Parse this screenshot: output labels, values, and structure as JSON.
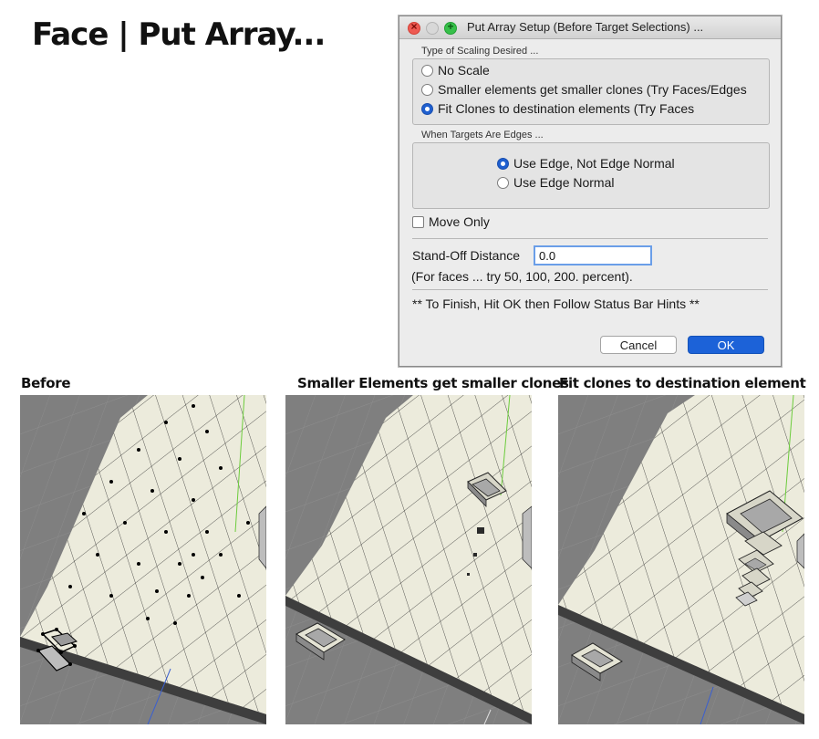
{
  "heading": "Face | Put Array...",
  "dialog": {
    "title": "Put Array Setup (Before Target Selections) ...",
    "scaling_group": {
      "label": "Type of Scaling Desired ...",
      "options": [
        {
          "label": "No Scale",
          "selected": false
        },
        {
          "label": "Smaller elements get smaller clones (Try Faces/Edges",
          "selected": false
        },
        {
          "label": "Fit Clones to destination elements (Try Faces",
          "selected": true
        }
      ]
    },
    "edges_group": {
      "label": "When Targets Are Edges ...",
      "options": [
        {
          "label": "Use Edge, Not Edge Normal",
          "selected": true
        },
        {
          "label": "Use Edge Normal",
          "selected": false
        }
      ]
    },
    "move_only": {
      "label": "Move Only",
      "checked": false
    },
    "standoff": {
      "label": "Stand-Off Distance",
      "value": "0.0"
    },
    "hint_faces": "(For faces ... try 50, 100, 200. percent).",
    "hint_finish": "** To Finish, Hit OK then Follow Status Bar Hints **",
    "buttons": {
      "cancel": "Cancel",
      "ok": "OK"
    },
    "colors": {
      "accent": "#1c62d8",
      "close": "#ee5a52",
      "zoom": "#37c04a"
    }
  },
  "panels": [
    {
      "caption": "Before"
    },
    {
      "caption": "Smaller Elements get smaller clones"
    },
    {
      "caption": "Fit clones to destination element"
    }
  ],
  "viewport_colors": {
    "ground": "#7f7f7f",
    "plane": "#ecebdc",
    "grid_line": "#2a2a2a",
    "axis_green": "#6ccc3c",
    "axis_blue": "#3a5fd0"
  }
}
